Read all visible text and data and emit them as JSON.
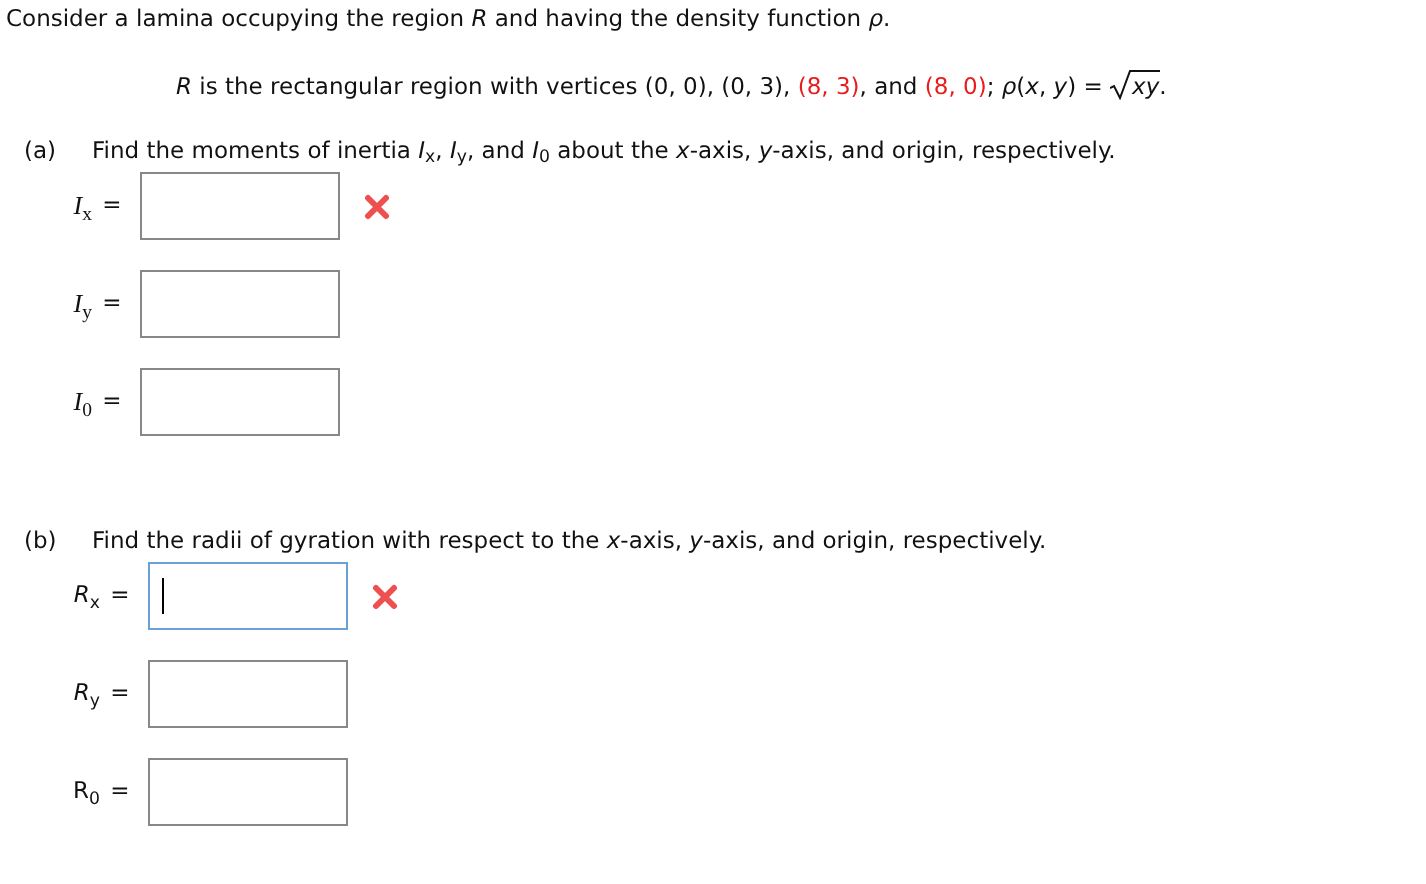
{
  "intro": "Consider a lamina occupying the region *R* and having the density function *ρ*.",
  "given": [
    {
      "kind": "text",
      "text": "*R* is the rectangular region with vertices (0, 0), (0, 3), "
    },
    {
      "kind": "text",
      "text": "(8, 3)",
      "color": "#e81c1c"
    },
    {
      "kind": "text",
      "text": ", and "
    },
    {
      "kind": "text",
      "text": "(8, 0)",
      "color": "#e81c1c"
    },
    {
      "kind": "text",
      "text": "; *ρ*(*x*, *y*) = "
    },
    {
      "kind": "sqrt",
      "text": "*xy*"
    },
    {
      "kind": "text",
      "text": "."
    }
  ],
  "parts": [
    {
      "marker": "(a)",
      "kind": "moments",
      "prompt": "Find the moments of inertia *I*$_{x}$, *I*$_{y}$, and *I*$_{0}$ about the *x*-axis, *y*-axis, and origin, respectively.",
      "fields": [
        {
          "label": "*I*$_{x}$",
          "equals": "=",
          "focused": false,
          "wrong": true
        },
        {
          "label": "*I*$_{y}$",
          "equals": "=",
          "focused": false,
          "wrong": false
        },
        {
          "label": "*I*$_{0}$",
          "equals": "=",
          "focused": false,
          "wrong": false
        }
      ]
    },
    {
      "marker": "(b)",
      "kind": "radii",
      "prompt": "Find the radii of gyration with respect to the *x*-axis, *y*-axis, and origin, respectively.",
      "fields": [
        {
          "label": "*R*$_{x}$",
          "equals": "=",
          "focused": true,
          "wrong": true
        },
        {
          "label": "*R*$_{y}$",
          "equals": "=",
          "focused": false,
          "wrong": false
        },
        {
          "label": "R$_{0}$",
          "equals": "=",
          "focused": false,
          "wrong": false
        }
      ]
    }
  ]
}
